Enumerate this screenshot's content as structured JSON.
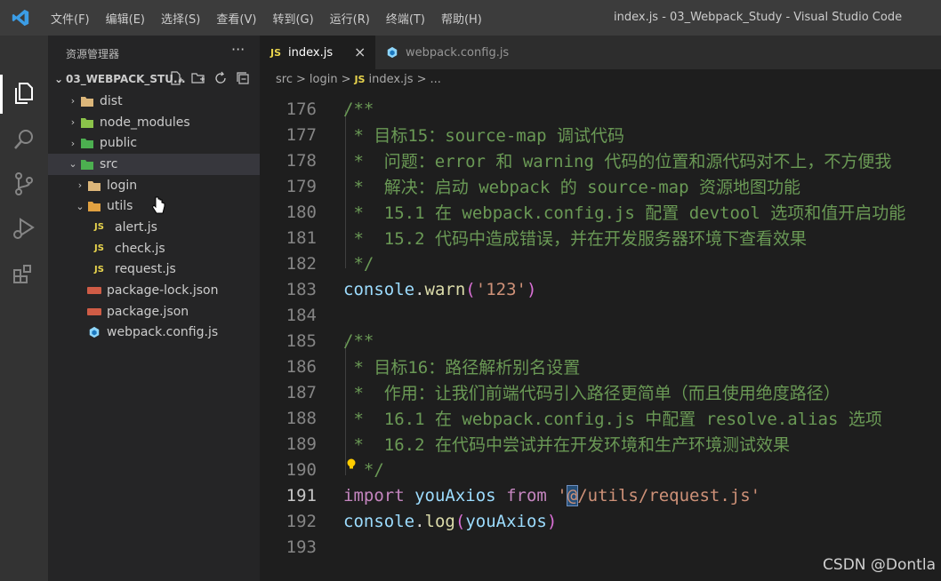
{
  "titlebar": {
    "menu": [
      "文件(F)",
      "编辑(E)",
      "选择(S)",
      "查看(V)",
      "转到(G)",
      "运行(R)",
      "终端(T)",
      "帮助(H)"
    ],
    "window_title": "index.js - 03_Webpack_Study - Visual Studio Code"
  },
  "activitybar": {
    "icons": [
      "explorer-icon",
      "search-icon",
      "source-control-icon",
      "run-debug-icon",
      "extensions-icon"
    ]
  },
  "sidebar": {
    "header": "资源管理器",
    "more": "···",
    "root": "03_WEBPACK_STU...",
    "tree": [
      {
        "label": "dist",
        "chev": "›",
        "indent": 1,
        "type": "folder"
      },
      {
        "label": "node_modules",
        "chev": "›",
        "indent": 1,
        "type": "folder-node"
      },
      {
        "label": "public",
        "chev": "›",
        "indent": 1,
        "type": "folder-public"
      },
      {
        "label": "src",
        "chev": "⌄",
        "indent": 1,
        "type": "folder-src",
        "selected": true
      },
      {
        "label": "login",
        "chev": "›",
        "indent": 2,
        "type": "folder"
      },
      {
        "label": "utils",
        "chev": "⌄",
        "indent": 2,
        "type": "folder-utils"
      },
      {
        "label": "alert.js",
        "chev": "",
        "indent": 3,
        "type": "js"
      },
      {
        "label": "check.js",
        "chev": "",
        "indent": 3,
        "type": "js"
      },
      {
        "label": "request.js",
        "chev": "",
        "indent": 3,
        "type": "js"
      },
      {
        "label": "package-lock.json",
        "chev": "",
        "indent": 2,
        "type": "json"
      },
      {
        "label": "package.json",
        "chev": "",
        "indent": 2,
        "type": "json"
      },
      {
        "label": "webpack.config.js",
        "chev": "",
        "indent": 2,
        "type": "webpack"
      }
    ]
  },
  "tabs": {
    "active": {
      "badge": "JS",
      "label": "index.js",
      "close": "×"
    },
    "inactive": {
      "label": "webpack.config.js"
    }
  },
  "breadcrumb": [
    "src",
    ">",
    "login",
    ">",
    "JS",
    "index.js",
    ">",
    "..."
  ],
  "editor": {
    "current_line": "191",
    "lines": [
      {
        "n": "176",
        "t": [
          [
            "c-comment",
            "/**"
          ]
        ]
      },
      {
        "n": "177",
        "t": [
          [
            "c-comment",
            " * 目标15：source-map 调试代码"
          ]
        ]
      },
      {
        "n": "178",
        "t": [
          [
            "c-comment",
            " *  问题：error 和 warning 代码的位置和源代码对不上，不方便我"
          ]
        ]
      },
      {
        "n": "179",
        "t": [
          [
            "c-comment",
            " *  解决：启动 webpack 的 source-map 资源地图功能"
          ]
        ]
      },
      {
        "n": "180",
        "t": [
          [
            "c-comment",
            " *  15.1 在 webpack.config.js 配置 devtool 选项和值开启功能"
          ]
        ]
      },
      {
        "n": "181",
        "t": [
          [
            "c-comment",
            " *  15.2 代码中造成错误，并在开发服务器环境下查看效果"
          ]
        ]
      },
      {
        "n": "182",
        "t": [
          [
            "c-comment",
            " */"
          ]
        ]
      },
      {
        "n": "183",
        "t": [
          [
            "c-var",
            "console"
          ],
          [
            "c-punc",
            "."
          ],
          [
            "c-fn",
            "warn"
          ],
          [
            "c-paren",
            "("
          ],
          [
            "c-str",
            "'123'"
          ],
          [
            "c-paren",
            ")"
          ]
        ]
      },
      {
        "n": "184",
        "t": []
      },
      {
        "n": "185",
        "t": [
          [
            "c-comment",
            "/**"
          ]
        ]
      },
      {
        "n": "186",
        "t": [
          [
            "c-comment",
            " * 目标16：路径解析别名设置"
          ]
        ]
      },
      {
        "n": "187",
        "t": [
          [
            "c-comment",
            " *  作用：让我们前端代码引入路径更简单（而且使用绝度路径）"
          ]
        ]
      },
      {
        "n": "188",
        "t": [
          [
            "c-comment",
            " *  16.1 在 webpack.config.js 中配置 resolve.alias 选项"
          ]
        ]
      },
      {
        "n": "189",
        "t": [
          [
            "c-comment",
            " *  16.2 在代码中尝试并在开发环境和生产环境测试效果"
          ]
        ]
      },
      {
        "n": "190",
        "t": [
          [
            "c-comment",
            "  */"
          ]
        ]
      },
      {
        "n": "191",
        "t": [
          [
            "c-kw",
            "import"
          ],
          [
            "c-punc",
            " "
          ],
          [
            "c-var",
            "youAxios"
          ],
          [
            "c-punc",
            " "
          ],
          [
            "c-kw",
            "from"
          ],
          [
            "c-punc",
            " "
          ],
          [
            "c-str",
            "'"
          ],
          [
            "cursor-mark c-str",
            "@"
          ],
          [
            "c-str",
            "/utils/request.js'"
          ]
        ]
      },
      {
        "n": "192",
        "t": [
          [
            "c-var",
            "console"
          ],
          [
            "c-punc",
            "."
          ],
          [
            "c-fn",
            "log"
          ],
          [
            "c-paren",
            "("
          ],
          [
            "c-var",
            "youAxios"
          ],
          [
            "c-paren",
            ")"
          ]
        ]
      },
      {
        "n": "193",
        "t": []
      }
    ]
  },
  "watermark": "CSDN @Dontla",
  "colors": {
    "titlebar": "#3c3c3c",
    "activitybar": "#333333",
    "sidebar": "#252526",
    "editor": "#1e1e1e",
    "comment": "#6a9955",
    "keyword": "#c586c0",
    "string": "#ce9178",
    "variable": "#9cdcfe",
    "function": "#dcdcaa",
    "js_badge": "#e8d44d"
  }
}
